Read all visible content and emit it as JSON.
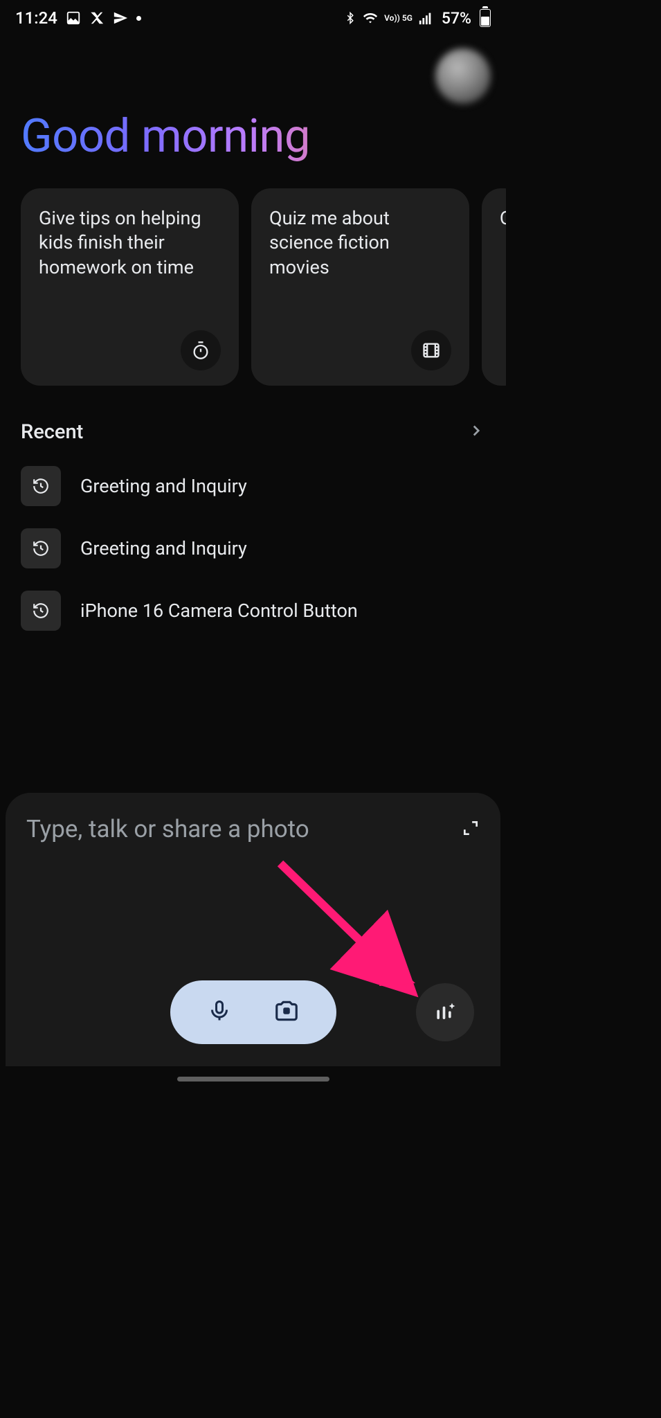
{
  "status": {
    "time": "11:24",
    "network_label": "Vo)) 5G",
    "battery_percent": "57%"
  },
  "profile": {},
  "greeting": "Good morning",
  "suggestions": [
    {
      "text": "Give tips on helping kids finish their homework on time",
      "icon": "timer-icon"
    },
    {
      "text": "Quiz me about science fiction movies",
      "icon": "movie-icon"
    },
    {
      "text": "Q",
      "icon": ""
    }
  ],
  "recent": {
    "title": "Recent",
    "items": [
      {
        "label": "Greeting and Inquiry"
      },
      {
        "label": "Greeting and Inquiry"
      },
      {
        "label": "iPhone 16 Camera Control Button"
      }
    ]
  },
  "input": {
    "placeholder": "Type, talk or share a photo"
  },
  "annotation": {
    "arrow_color": "#ff1a75"
  }
}
